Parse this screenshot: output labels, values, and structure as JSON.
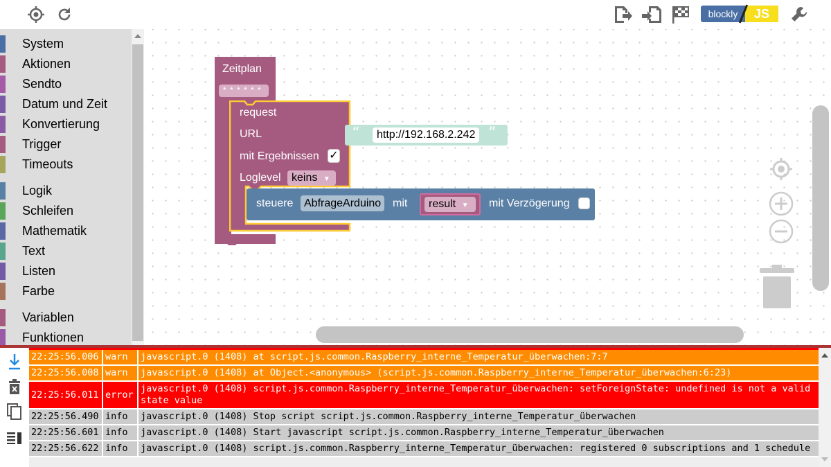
{
  "toolbar": {
    "left_buttons": [
      {
        "name": "locate-icon"
      },
      {
        "name": "refresh-icon"
      }
    ],
    "right_buttons": [
      {
        "name": "export-icon"
      },
      {
        "name": "import-icon"
      },
      {
        "name": "checkered-flag-icon"
      }
    ],
    "blockly_label": "blockly",
    "js_label": "JS"
  },
  "sidebar": {
    "groups": [
      [
        {
          "label": "System",
          "color": "#4a6fa5"
        },
        {
          "label": "Aktionen",
          "color": "#a55b80"
        },
        {
          "label": "Sendto",
          "color": "#a55ba5"
        },
        {
          "label": "Datum und Zeit",
          "color": "#7a5ba5"
        },
        {
          "label": "Konvertierung",
          "color": "#8a5ba5"
        },
        {
          "label": "Trigger",
          "color": "#a55b80"
        },
        {
          "label": "Timeouts",
          "color": "#a5a55b"
        }
      ],
      [
        {
          "label": "Logik",
          "color": "#5b80a5"
        },
        {
          "label": "Schleifen",
          "color": "#5ba55b"
        },
        {
          "label": "Mathematik",
          "color": "#5b67a5"
        },
        {
          "label": "Text",
          "color": "#5ba58c"
        },
        {
          "label": "Listen",
          "color": "#745ba5"
        },
        {
          "label": "Farbe",
          "color": "#a5745b"
        }
      ],
      [
        {
          "label": "Variablen",
          "color": "#a55b80"
        },
        {
          "label": "Funktionen",
          "color": "#995ba5"
        }
      ]
    ]
  },
  "workspace": {
    "schedule_block": {
      "title": "Zeitplan",
      "cron": "* * * * * *"
    },
    "request_block": {
      "title": "request",
      "url_label": "URL",
      "url_value": "http://192.168.2.242",
      "results_label": "mit Ergebnissen",
      "results_checked": "✓",
      "loglevel_label": "Loglevel",
      "loglevel_value": "keins"
    },
    "control_block": {
      "label": "steuere",
      "target": "AbfrageArduino",
      "with_label": "mit",
      "value": "result",
      "delay_label": "mit Verzögerung"
    }
  },
  "log": {
    "rows": [
      {
        "time": "22:25:56.006",
        "level": "warn",
        "message": "javascript.0 (1408) at script.js.common.Raspberry_interne_Temperatur_überwachen:7:7"
      },
      {
        "time": "22:25:56.008",
        "level": "warn",
        "message": "javascript.0 (1408) at Object.<anonymous> (script.js.common.Raspberry_interne_Temperatur_überwachen:6:23)"
      },
      {
        "time": "22:25:56.011",
        "level": "error",
        "message": "javascript.0 (1408) script.js.common.Raspberry_interne_Temperatur_überwachen: setForeignState: undefined is not a valid state value"
      },
      {
        "time": "22:25:56.490",
        "level": "info",
        "message": "javascript.0 (1408) Stop script script.js.common.Raspberry_interne_Temperatur_überwachen"
      },
      {
        "time": "22:25:56.601",
        "level": "info",
        "message": "javascript.0 (1408) Start javascript script.js.common.Raspberry_interne_Temperatur_überwachen"
      },
      {
        "time": "22:25:56.622",
        "level": "info",
        "message": "javascript.0 (1408) script.js.common.Raspberry_interne_Temperatur_überwachen: registered 0 subscriptions and 1 schedule"
      }
    ]
  },
  "colors": {
    "schedule": "#a55b80",
    "control": "#5b80a5",
    "text_block": "#5ba58c",
    "highlight": "#fc3",
    "warn": "#ff8c00",
    "error": "#ff0000",
    "info": "#cccccc"
  }
}
